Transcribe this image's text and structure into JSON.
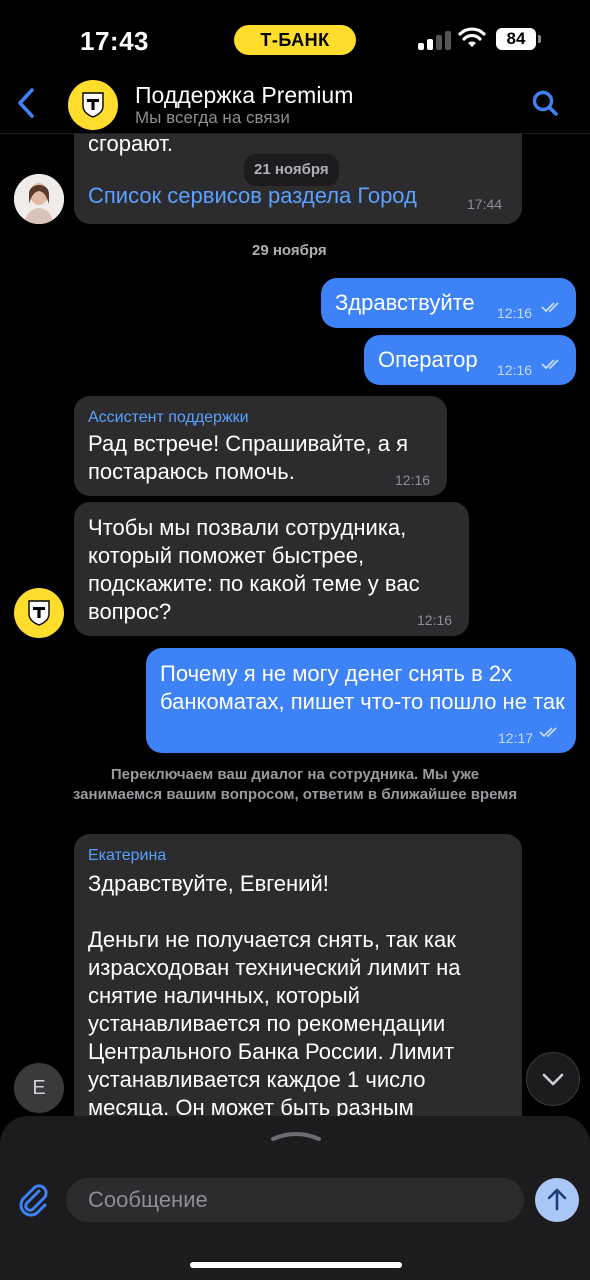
{
  "status_bar": {
    "time": "17:43",
    "carrier": "Т-БАНК",
    "battery": "84"
  },
  "header": {
    "title": "Поддержка Premium",
    "subtitle": "Мы всегда на связи"
  },
  "messages": {
    "m0": {
      "text": "сгорают."
    },
    "date_nov21": "21 ноября",
    "m1": {
      "link": "Список сервисов раздела Город",
      "time": "17:44"
    },
    "date_nov29": "29 ноября",
    "m2": {
      "text": "Здравствуйте",
      "time": "12:16"
    },
    "m3": {
      "text": "Оператор",
      "time": "12:16"
    },
    "m4": {
      "sender": "Ассистент поддержки",
      "text": "Рад встрече! Спрашивайте, а я постараюсь помочь.",
      "time": "12:16"
    },
    "m5": {
      "text": "Чтобы мы позвали сотрудника, который поможет быстрее, подскажите: по какой теме у вас вопрос?",
      "time": "12:16"
    },
    "m6": {
      "text": "Почему я не могу денег снять в 2х банкоматах, пишет что-то пошло не так",
      "time": "12:17"
    },
    "system": "Переключаем ваш диалог на сотрудника. Мы уже занимаемся вашим вопросом, ответим в ближайшее время",
    "m7": {
      "sender": "Екатерина",
      "greeting": "Здравствуйте, Евгений!",
      "text": "Деньги не получается снять, так как израсходован технический лимит на снятие наличных, который устанавливается по рекомендации Центрального Банка России. Лимит устанавливается каждое 1 число месяца. Он может быть разным"
    },
    "operator_initial": "E"
  },
  "composer": {
    "placeholder": "Сообщение"
  },
  "colors": {
    "accent": "#3d82f6",
    "brand": "#ffdd2d",
    "bubble_in": "#2c2c2e",
    "link": "#5aa0ff"
  },
  "icons": [
    "back-arrow-icon",
    "search-icon",
    "paperclip-icon",
    "send-arrow-icon",
    "chevron-down-icon",
    "double-check-icon",
    "bank-shield-icon"
  ]
}
